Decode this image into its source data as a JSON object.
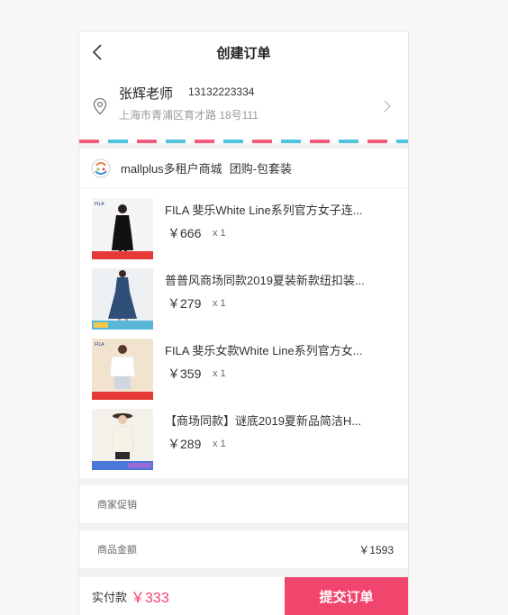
{
  "header": {
    "title": "创建订单",
    "back_icon": "chevron-left-icon"
  },
  "address": {
    "name": "张辉老师",
    "phone": "13132223334",
    "detail": "上海市青浦区育才路 18号111",
    "location_icon": "location-pin-icon",
    "arrow_icon": "chevron-right-icon"
  },
  "store": {
    "name": "mallplus多租户商城",
    "type": "团购-包套装"
  },
  "goods": [
    {
      "name": "FILA 斐乐White Line系列官方女子连...",
      "price": "￥666",
      "qty": "x 1"
    },
    {
      "name": "普普风商场同款2019夏装新款纽扣装...",
      "price": "￥279",
      "qty": "x 1"
    },
    {
      "name": "FILA 斐乐女款White Line系列官方女...",
      "price": "￥359",
      "qty": "x 1"
    },
    {
      "name": "【商场同款】谜底2019夏新品简洁H...",
      "price": "￥289",
      "qty": "x 1"
    }
  ],
  "promo": {
    "label": "商家促销"
  },
  "amount": {
    "label": "商品金额",
    "value": "￥1593"
  },
  "footer": {
    "pay_label": "实付款",
    "pay_total": "￥333",
    "submit_label": "提交订单"
  },
  "colors": {
    "accent": "#f2456e",
    "stripe_pink": "#ef5d7a",
    "stripe_blue": "#4fc3de"
  }
}
